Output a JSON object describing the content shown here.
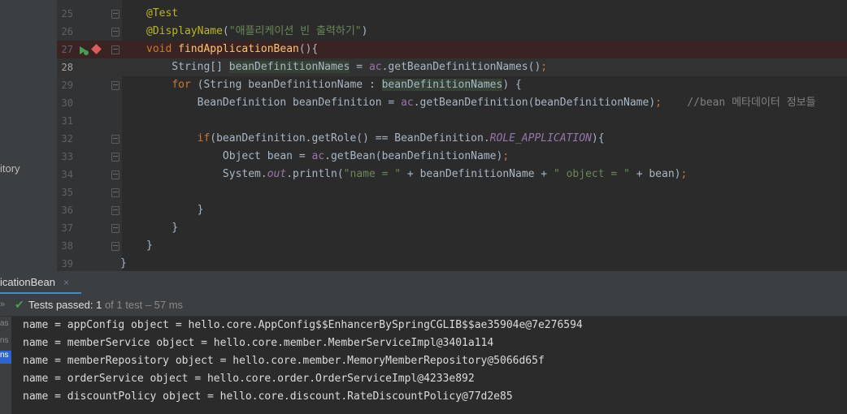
{
  "project_panel": {
    "label": "itory"
  },
  "editor": {
    "lines": [
      {
        "num": "25",
        "html": "<span class=\"ann\">@Test</span>"
      },
      {
        "num": "26",
        "html": "<span class=\"ann\">@DisplayName</span>(<span class=\"str\">\"애플리케이션 빈 출력하기\"</span>)"
      },
      {
        "num": "27",
        "html": "<span class=\"kw\">void </span><span class=\"fn\">findApplicationBean</span>(){"
      },
      {
        "num": "28",
        "html": "    String[] <span class=\"hl\">beanDefinitionNames</span> = <span class=\"fld\" style=\"font-style:normal\">ac</span>.getBeanDefinitionNames()<span class=\"kw\">;</span>"
      },
      {
        "num": "29",
        "html": "    <span class=\"kw\">for </span>(String beanDefinitionName : <span class=\"hl\">beanDefinitionNames</span>) {"
      },
      {
        "num": "30",
        "html": "        BeanDefinition beanDefinition = <span class=\"fld\" style=\"font-style:normal\">ac</span>.getBeanDefinition(beanDefinitionName)<span class=\"kw\">;    </span><span class=\"cmt\">//bean 메타데이터 정보들</span>"
      },
      {
        "num": "31",
        "html": ""
      },
      {
        "num": "32",
        "html": "        <span class=\"kw\">if</span>(beanDefinition.getRole() == BeanDefinition.<span class=\"fld\">ROLE_APPLICATION</span>){"
      },
      {
        "num": "33",
        "html": "            Object bean = <span class=\"fld\" style=\"font-style:normal\">ac</span>.getBean(beanDefinitionName)<span class=\"kw\">;</span>"
      },
      {
        "num": "34",
        "html": "            System.<span class=\"fld\">out</span>.println(<span class=\"str\">\"name = \"</span> + beanDefinitionName + <span class=\"str\">\" object = \"</span> + bean)<span class=\"kw\">;</span>"
      },
      {
        "num": "35",
        "html": ""
      },
      {
        "num": "36",
        "html": "        }"
      },
      {
        "num": "37",
        "html": "    }"
      },
      {
        "num": "38",
        "html": "}"
      },
      {
        "num": "39",
        "html": "}"
      }
    ]
  },
  "run_tab": {
    "label": "icationBean",
    "close": "×"
  },
  "status": {
    "prefix": "Tests passed: ",
    "count": "1",
    "rest": " of 1 test – 57 ms"
  },
  "left_tools": [
    "as",
    "ns",
    "ns"
  ],
  "console": [
    "name = appConfig object = hello.core.AppConfig$$EnhancerBySpringCGLIB$$ae35904e@7e276594",
    "name = memberService object = hello.core.member.MemberServiceImpl@3401a114",
    "name = memberRepository object = hello.core.member.MemoryMemberRepository@5066d65f",
    "name = orderService object = hello.core.order.OrderServiceImpl@4233e892",
    "name = discountPolicy object = hello.core.discount.RateDiscountPolicy@77d2e85"
  ],
  "colors": {
    "accent": "#4a88c7",
    "passed": "#499c54",
    "breakpoint": "#db5c5c"
  }
}
